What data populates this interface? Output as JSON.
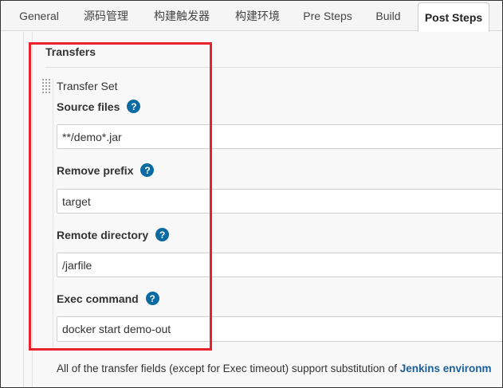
{
  "tabs": [
    {
      "label": "General",
      "active": false
    },
    {
      "label": "源码管理",
      "active": false
    },
    {
      "label": "构建触发器",
      "active": false
    },
    {
      "label": "构建环境",
      "active": false
    },
    {
      "label": "Pre Steps",
      "active": false
    },
    {
      "label": "Build",
      "active": false
    },
    {
      "label": "Post Steps",
      "active": true
    }
  ],
  "section": {
    "title": "Transfers",
    "set_title": "Transfer Set"
  },
  "fields": {
    "source_files": {
      "label": "Source files",
      "value": "**/demo*.jar"
    },
    "remove_prefix": {
      "label": "Remove prefix",
      "value": "target"
    },
    "remote_directory": {
      "label": "Remote directory",
      "value": "/jarfile"
    },
    "exec_command": {
      "label": "Exec command",
      "value": "docker start demo-out"
    }
  },
  "help_icon_glyph": "?",
  "note": {
    "text": "All of the transfer fields (except for Exec timeout) support substitution of ",
    "link": "Jenkins environm"
  },
  "colors": {
    "help_icon": "#0b6aa2",
    "highlight_box": "#e8232b",
    "link": "#1b5f9a"
  }
}
